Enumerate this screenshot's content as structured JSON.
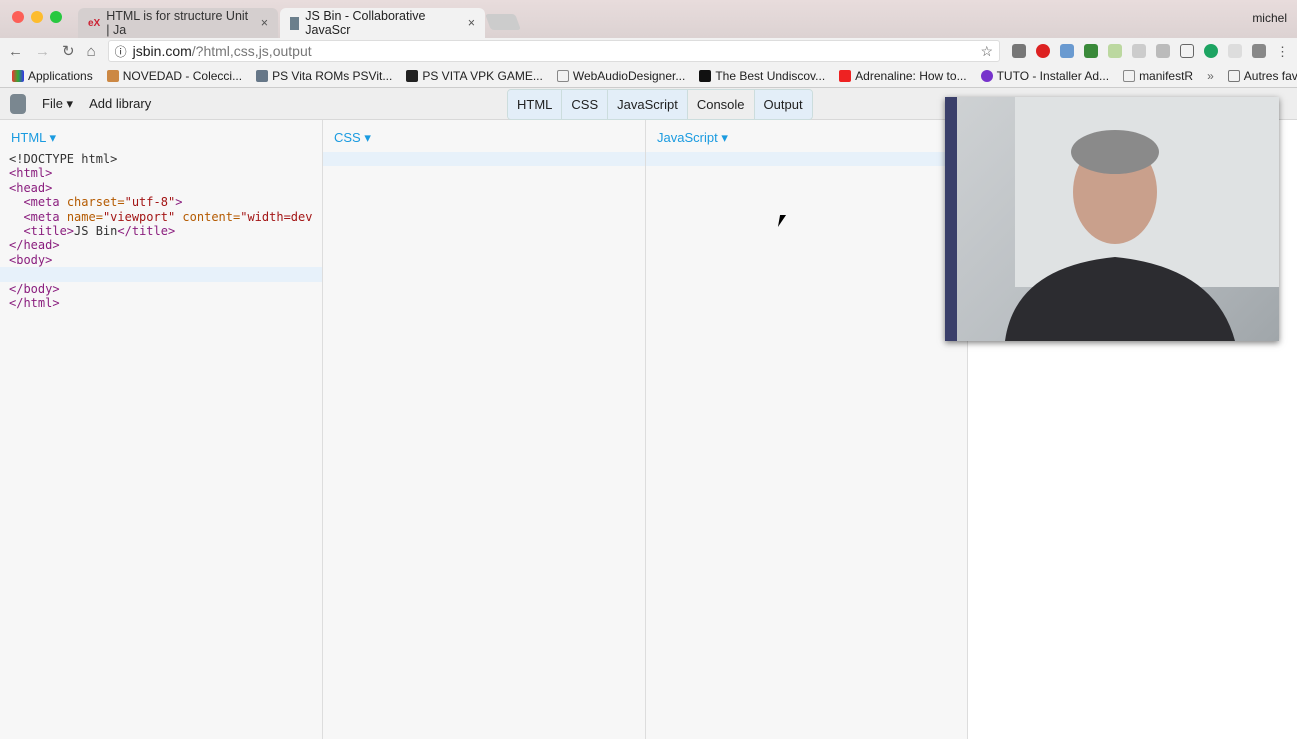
{
  "browser": {
    "tabs": [
      {
        "label": "HTML is for structure Unit | Ja",
        "icon": "edx-icon"
      },
      {
        "label": "JS Bin - Collaborative JavaScr",
        "icon": "jsbin-icon"
      }
    ],
    "close": "×",
    "user": "michel",
    "url_host": "jsbin.com",
    "url_path": "/?html,css,js,output",
    "bookmarks": [
      "Applications",
      "NOVEDAD - Colecci...",
      "PS Vita ROMs PSVit...",
      "PS VITA VPK GAME...",
      "WebAudioDesigner...",
      "The Best Undiscov...",
      "Adrenaline: How to...",
      "TUTO - Installer Ad...",
      "manifestR"
    ],
    "more": "»",
    "other_bookmarks": "Autres favoris"
  },
  "jsbin": {
    "file": "File ▾",
    "add_library": "Add library",
    "panels": [
      "HTML",
      "CSS",
      "JavaScript",
      "Console",
      "Output"
    ],
    "panes": [
      {
        "label": "HTML"
      },
      {
        "label": "CSS"
      },
      {
        "label": "JavaScript"
      }
    ],
    "html_code": [
      [
        [
          "tx",
          "<!DOCTYPE html>"
        ]
      ],
      [
        [
          "tg",
          "<html>"
        ]
      ],
      [
        [
          "tg",
          "<head>"
        ]
      ],
      [
        [
          "tx",
          "  "
        ],
        [
          "tg",
          "<meta "
        ],
        [
          "at",
          "charset="
        ],
        [
          "st",
          "\"utf-8\""
        ],
        [
          "tg",
          ">"
        ]
      ],
      [
        [
          "tx",
          "  "
        ],
        [
          "tg",
          "<meta "
        ],
        [
          "at",
          "name="
        ],
        [
          "st",
          "\"viewport\" "
        ],
        [
          "at",
          "content="
        ],
        [
          "st",
          "\"width=dev"
        ]
      ],
      [
        [
          "tx",
          "  "
        ],
        [
          "tg",
          "<title>"
        ],
        [
          "tx",
          "JS Bin"
        ],
        [
          "tg",
          "</title>"
        ]
      ],
      [
        [
          "tg",
          "</head>"
        ]
      ],
      [
        [
          "tg",
          "<body>"
        ]
      ],
      [
        [
          "tx",
          ""
        ]
      ],
      [
        [
          "tg",
          "</body>"
        ]
      ],
      [
        [
          "tg",
          "</html>"
        ]
      ]
    ],
    "active_line": 8
  },
  "colors": {
    "accent": "#1a9be0",
    "tag": "#8a1e7e",
    "attr": "#b45a00",
    "string": "#a31515"
  }
}
